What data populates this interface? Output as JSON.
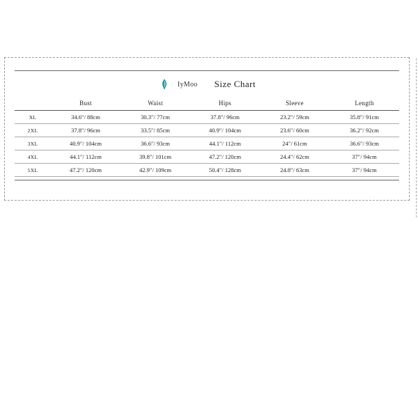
{
  "brand": "IyMoo",
  "title": "Size Chart",
  "columns": [
    "",
    "Bust",
    "Waist",
    "Hips",
    "Sleeve",
    "Length"
  ],
  "rows": [
    {
      "size": "XL",
      "bust": "34.6″/ 88cm",
      "waist": "30.3″/ 77cm",
      "hips": "37.8″/ 96cm",
      "sleeve": "23.2″/ 59cm",
      "length": "35.8″/ 91cm"
    },
    {
      "size": "2XL",
      "bust": "37.8″/ 96cm",
      "waist": "33.5″/ 85cm",
      "hips": "40.9″/ 104cm",
      "sleeve": "23.6″/ 60cm",
      "length": "36.2″/ 92cm"
    },
    {
      "size": "3XL",
      "bust": "40.9″/ 104cm",
      "waist": "36.6″/ 93cm",
      "hips": "44.1″/ 112cm",
      "sleeve": "24″/ 61cm",
      "length": "36.6″/ 93cm"
    },
    {
      "size": "4XL",
      "bust": "44.1″/ 112cm",
      "waist": "39.8″/ 101cm",
      "hips": "47.2″/ 120cm",
      "sleeve": "24.4″/ 62cm",
      "length": "37″/ 94cm"
    },
    {
      "size": "5XL",
      "bust": "47.2″/ 120cm",
      "waist": "42.9″/ 109cm",
      "hips": "50.4″/ 128cm",
      "sleeve": "24.8″/ 63cm",
      "length": "37″/ 94cm"
    }
  ]
}
